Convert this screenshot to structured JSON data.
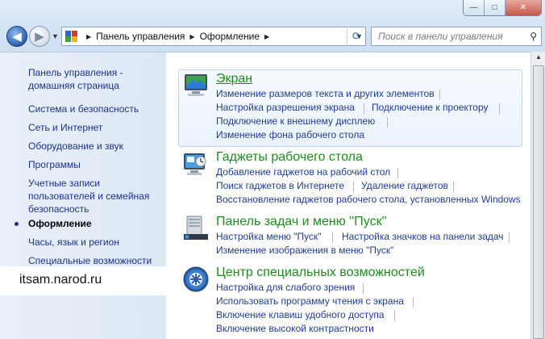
{
  "window": {
    "minimize": "—",
    "maximize": "□",
    "close": "✕"
  },
  "nav": {
    "back_icon": "◀",
    "forward_icon": "▶",
    "history_icon": "▼",
    "refresh_icon": "⟳"
  },
  "address": {
    "crumbs": [
      "Панель управления",
      "Оформление"
    ],
    "dropdown_icon": "▼"
  },
  "search": {
    "placeholder": "Поиск в панели управления"
  },
  "sidebar": {
    "home": "Панель управления -\nдомашняя страница",
    "items": [
      "Система и безопасность",
      "Сеть и Интернет",
      "Оборудование и звук",
      "Программы",
      "Учетные записи\nпользователей и семейная\nбезопасность",
      "Оформление",
      "Часы, язык и регион",
      "Специальные возможности"
    ],
    "active_index": 5,
    "watermark": "itsam.narod.ru"
  },
  "categories": [
    {
      "title": "Экран",
      "icon": "display-icon",
      "tasks": [
        "Изменение размеров текста и других элементов",
        "Настройка разрешения экрана",
        "Подключение к проектору",
        "Подключение к внешнему дисплею",
        "Изменение фона рабочего стола"
      ]
    },
    {
      "title": "Гаджеты рабочего стола",
      "icon": "gadgets-icon",
      "tasks": [
        "Добавление гаджетов на рабочий стол",
        "Поиск гаджетов в Интернете",
        "Удаление гаджетов",
        "Восстановление гаджетов рабочего стола, установленных Windows"
      ]
    },
    {
      "title": "Панель задач и меню ''Пуск''",
      "icon": "taskbar-icon",
      "tasks": [
        "Настройка меню \"Пуск\"",
        "Настройка значков на панели задач",
        "Изменение изображения в меню \"Пуск\""
      ]
    },
    {
      "title": "Центр специальных возможностей",
      "icon": "accessibility-icon",
      "tasks": [
        "Настройка для слабого зрения",
        "Использовать программу чтения с экрана",
        "Включение клавиш удобного доступа",
        "Включение высокой контрастности"
      ]
    }
  ],
  "colors": {
    "category_title": "#1e8d1e",
    "task_link": "#1e3c96",
    "sidebar_link": "#1e3287"
  }
}
